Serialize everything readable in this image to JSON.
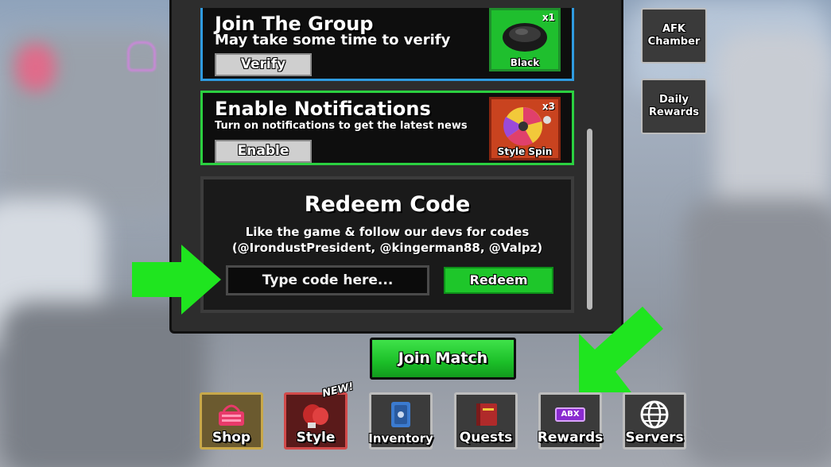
{
  "tasks": {
    "group": {
      "title": "Join The Group",
      "subtitle": "May take some time to verify",
      "button": "Verify",
      "reward_count": "x1",
      "reward_name": "Black"
    },
    "notifications": {
      "title": "Enable Notifications",
      "subtitle": "Turn on notifications to get the latest news",
      "button": "Enable",
      "reward_count": "x3",
      "reward_name": "Style Spin"
    }
  },
  "redeem": {
    "title": "Redeem Code",
    "description_line1": "Like the game & follow our devs for codes",
    "description_line2": "(@IrondustPresident, @kingerman88,  @Valpz)",
    "input_placeholder": "Type code here...",
    "input_value": "",
    "button": "Redeem"
  },
  "join_match": "Join Match",
  "side_buttons": {
    "afk": "AFK Chamber",
    "daily": "Daily Rewards"
  },
  "dock": {
    "shop": "Shop",
    "style": "Style",
    "style_badge": "NEW!",
    "inventory": "Inventory",
    "quests": "Quests",
    "rewards": "Rewards",
    "rewards_icon_text": "ABX",
    "servers": "Servers"
  },
  "colors": {
    "accent_green": "#1ec62a",
    "group_border": "#2f9be0",
    "notif_border": "#2bd040"
  }
}
